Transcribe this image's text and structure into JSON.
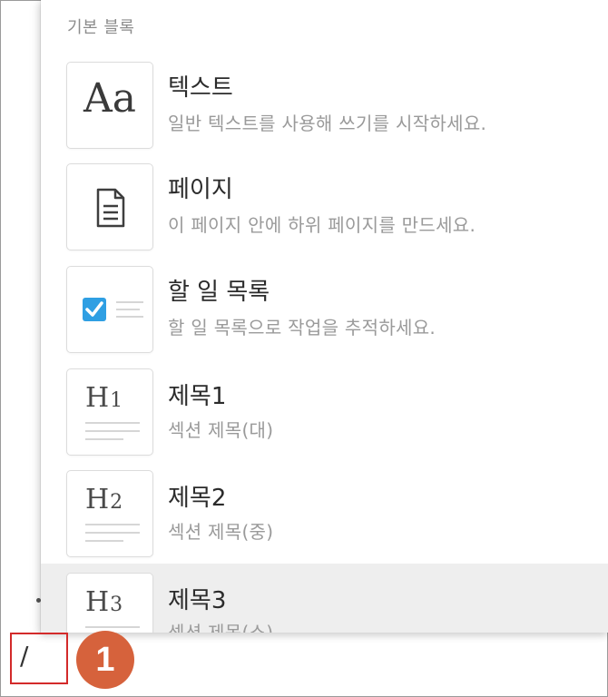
{
  "menu": {
    "section_title": "기본 블록",
    "items": [
      {
        "title": "텍스트",
        "description": "일반 텍스트를 사용해 쓰기를 시작하세요.",
        "icon": "text-aa-icon",
        "glyph": "Aa"
      },
      {
        "title": "페이지",
        "description": "이 페이지 안에 하위 페이지를 만드세요.",
        "icon": "page-document-icon"
      },
      {
        "title": "할 일 목록",
        "description": "할 일 목록으로 작업을 추적하세요.",
        "icon": "todo-checkbox-icon"
      },
      {
        "title": "제목1",
        "description": "섹션 제목(대)",
        "icon": "heading1-icon",
        "glyph_letter": "H",
        "glyph_num": "1"
      },
      {
        "title": "제목2",
        "description": "섹션 제목(중)",
        "icon": "heading2-icon",
        "glyph_letter": "H",
        "glyph_num": "2"
      },
      {
        "title": "제목3",
        "description": "섹션 제목(소)",
        "icon": "heading3-icon",
        "glyph_letter": "H",
        "glyph_num": "3"
      }
    ],
    "hovered_index": 5,
    "checkbox_color": "#2f9fe3"
  },
  "editor": {
    "input_text": "/"
  },
  "annotation": {
    "step_number": "1",
    "highlight_color": "#d32a2a",
    "badge_color": "#d6623c"
  }
}
